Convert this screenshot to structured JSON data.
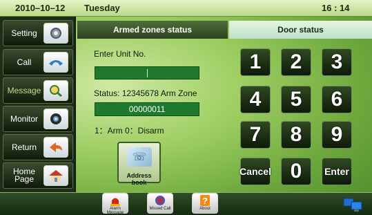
{
  "status_bar": {
    "date": "2010–10–12",
    "day": "Tuesday",
    "time": "16 : 14"
  },
  "sidebar": {
    "items": [
      {
        "label": "Setting",
        "icon": "gear-icon"
      },
      {
        "label": "Call",
        "icon": "phone-icon"
      },
      {
        "label": "Message",
        "icon": "magnifier-icon"
      },
      {
        "label": "Monitor",
        "icon": "camera-icon"
      },
      {
        "label": "Return",
        "icon": "return-arrow-icon"
      },
      {
        "label": "Home Page",
        "icon": "house-icon"
      }
    ]
  },
  "tabs": {
    "armed": "Armed zones status",
    "door": "Door status"
  },
  "form": {
    "unit_label": "Enter Unit No.",
    "unit_value": "",
    "status_label": "Status: 12345678 Arm Zone",
    "arm_value": "00000011",
    "legend": "1：Arm  0：Disarm",
    "address_book": "Address book"
  },
  "keypad": [
    "1",
    "2",
    "3",
    "4",
    "5",
    "6",
    "7",
    "8",
    "9",
    "Cancel",
    "0",
    "Enter"
  ],
  "bottom": {
    "alarm_message": "Alarm Message",
    "missed_call": "Missed Call",
    "about": "About"
  },
  "colors": {
    "accent_green": "#1f7a2e",
    "dark_panel": "#1f2f16"
  }
}
